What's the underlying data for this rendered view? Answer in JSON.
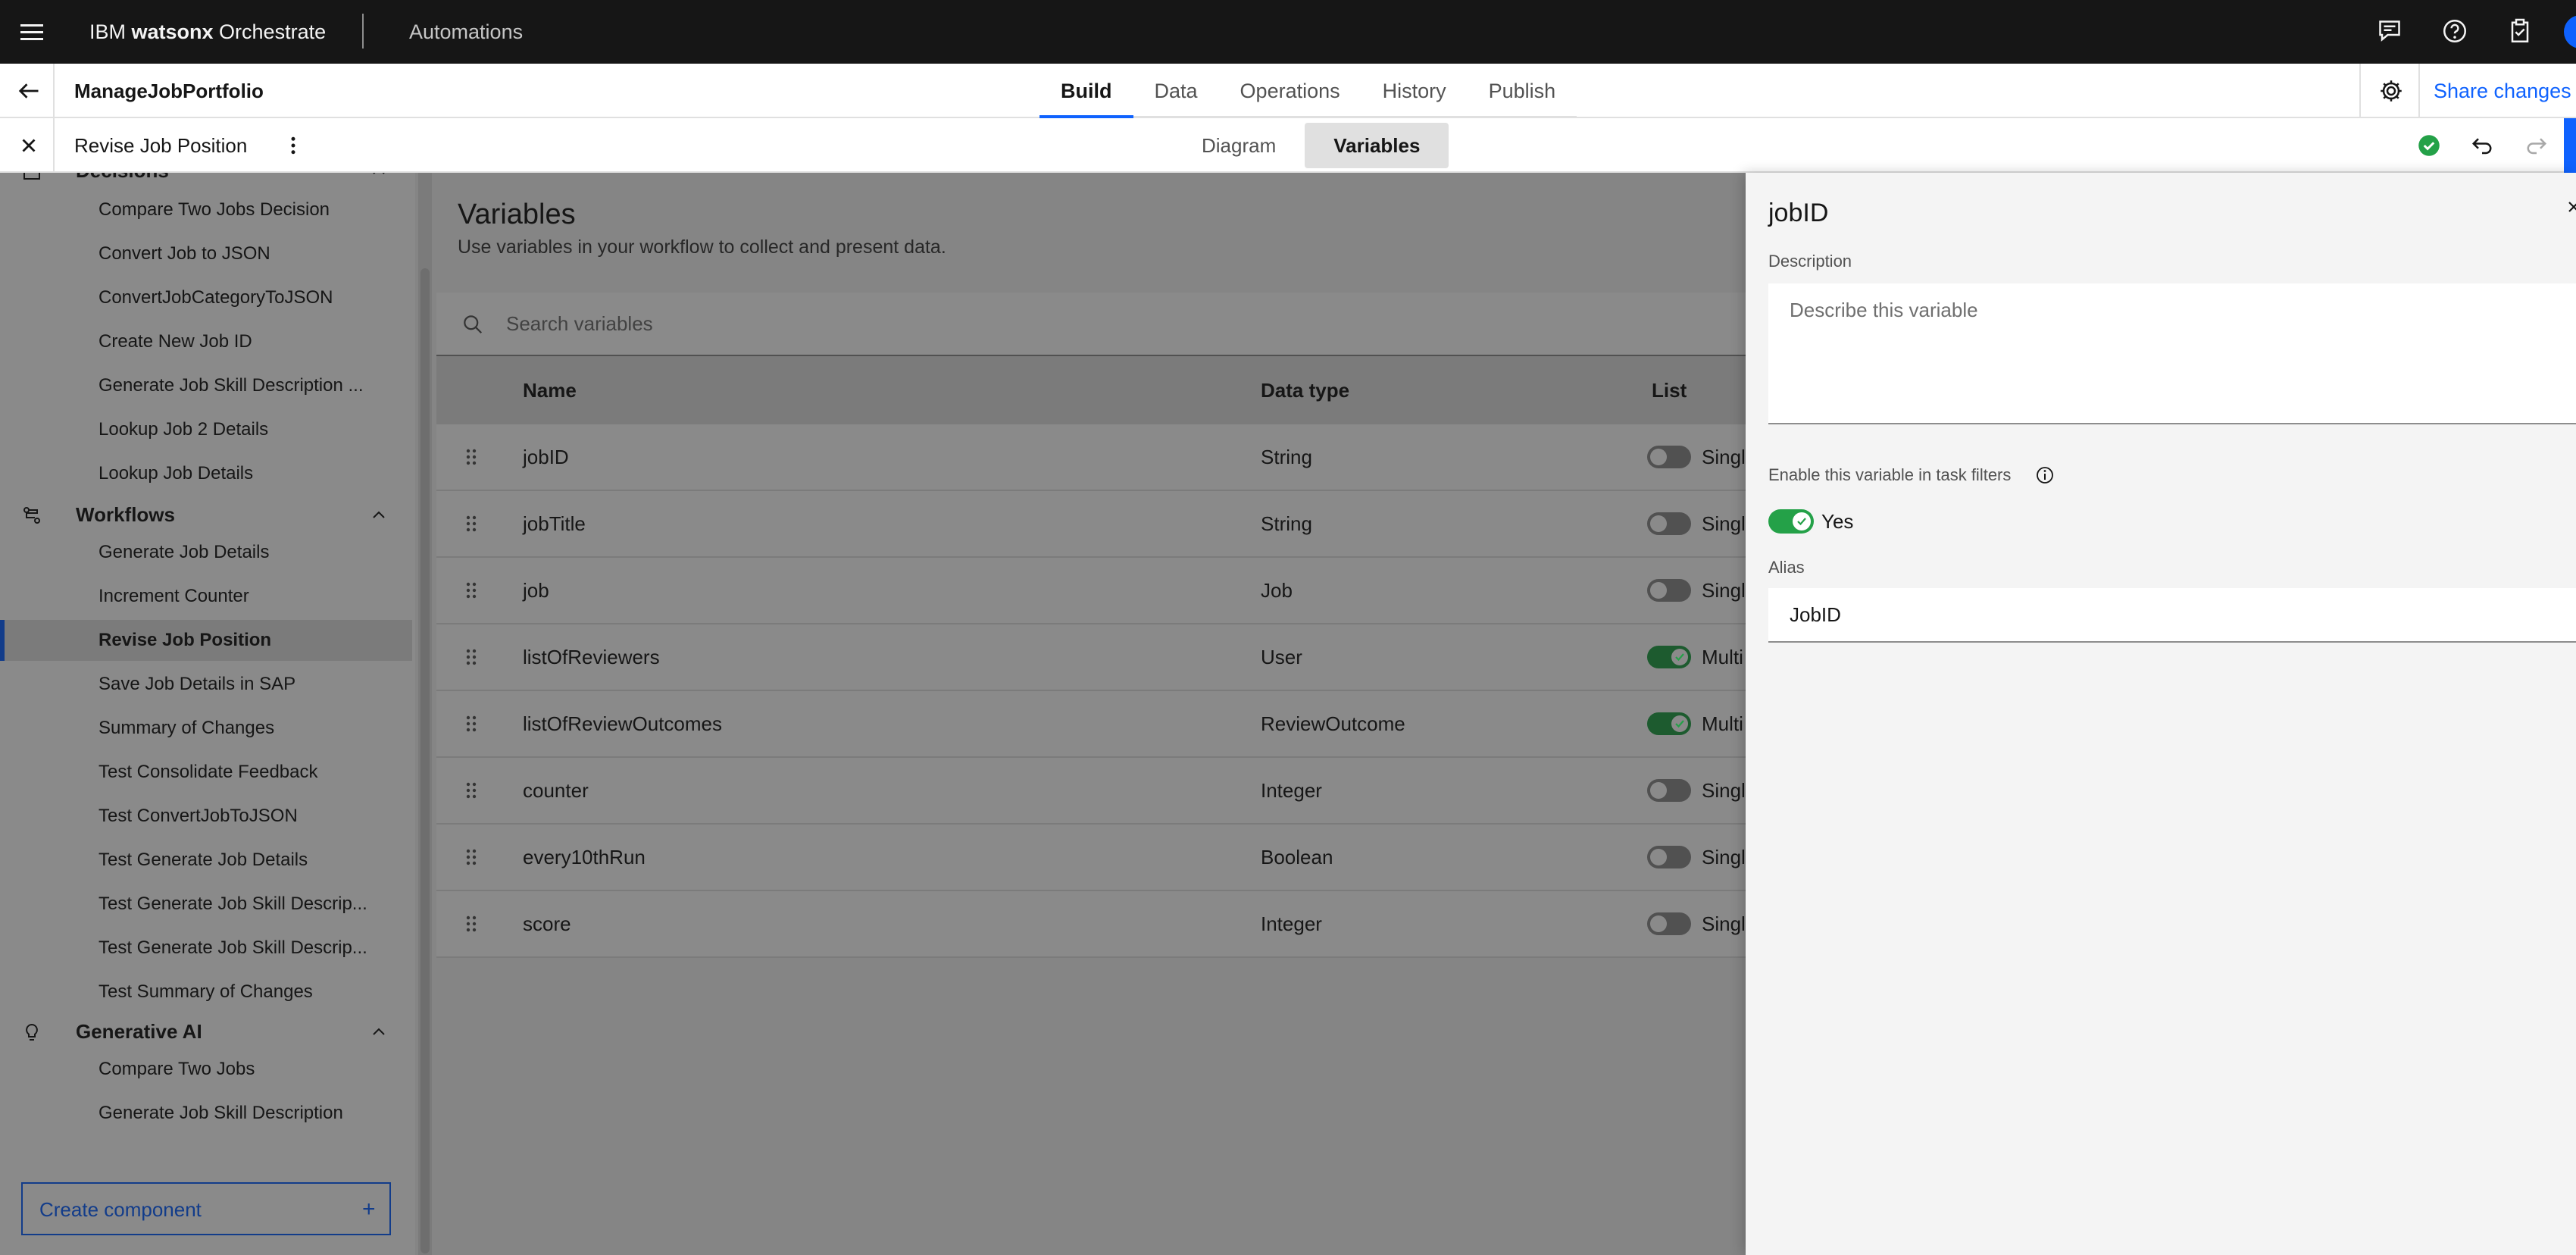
{
  "topbar": {
    "brand_prefix": "IBM ",
    "brand_bold": "watsonx",
    "brand_suffix": " Orchestrate",
    "breadcrumb": "Automations",
    "icons": [
      "chat-icon",
      "help-icon",
      "clipboard-icon",
      "avatar"
    ]
  },
  "project": {
    "name": "ManageJobPortfolio",
    "tabs": [
      {
        "label": "Build",
        "active": true
      },
      {
        "label": "Data",
        "active": false
      },
      {
        "label": "Operations",
        "active": false
      },
      {
        "label": "History",
        "active": false
      },
      {
        "label": "Publish",
        "active": false
      }
    ],
    "share_label": "Share changes"
  },
  "workflow": {
    "title": "Revise Job Position",
    "segments": [
      {
        "label": "Diagram",
        "active": false
      },
      {
        "label": "Variables",
        "active": true
      }
    ]
  },
  "sidebar": {
    "groups": [
      {
        "label": "Decisions",
        "items": [
          "Compare Two Jobs Decision",
          "Convert Job to JSON",
          "ConvertJobCategoryToJSON",
          "Create New Job ID",
          "Generate Job Skill Description ...",
          "Lookup Job 2 Details",
          "Lookup Job Details"
        ]
      },
      {
        "label": "Workflows",
        "items": [
          "Generate Job Details",
          "Increment Counter",
          "Revise Job Position",
          "Save Job Details in SAP",
          "Summary of Changes",
          "Test Consolidate Feedback",
          "Test ConvertJobToJSON",
          "Test Generate Job Details",
          "Test Generate Job Skill Descrip...",
          "Test Generate Job Skill Descrip...",
          "Test Summary of Changes"
        ]
      },
      {
        "label": "Generative AI",
        "items": [
          "Compare Two Jobs",
          "Generate Job Skill Description"
        ]
      }
    ],
    "active_item": "Revise Job Position",
    "create_label": "Create component",
    "create_plus": "+"
  },
  "variables": {
    "title": "Variables",
    "subtitle": "Use variables in your workflow to collect and present data.",
    "search_placeholder": "Search variables",
    "columns": [
      "Name",
      "Data type",
      "List"
    ],
    "rows": [
      {
        "name": "jobID",
        "type": "String",
        "list": false,
        "list_label": "Singl"
      },
      {
        "name": "jobTitle",
        "type": "String",
        "list": false,
        "list_label": "Singl"
      },
      {
        "name": "job",
        "type": "Job",
        "list": false,
        "list_label": "Singl"
      },
      {
        "name": "listOfReviewers",
        "type": "User",
        "list": true,
        "list_label": "Multi"
      },
      {
        "name": "listOfReviewOutcomes",
        "type": "ReviewOutcome",
        "list": true,
        "list_label": "Multi"
      },
      {
        "name": "counter",
        "type": "Integer",
        "list": false,
        "list_label": "Singl"
      },
      {
        "name": "every10thRun",
        "type": "Boolean",
        "list": false,
        "list_label": "Singl"
      },
      {
        "name": "score",
        "type": "Integer",
        "list": false,
        "list_label": "Singl"
      }
    ]
  },
  "panel": {
    "title": "jobID",
    "description_label": "Description",
    "description_placeholder": "Describe this variable",
    "enable_label": "Enable this variable in task filters",
    "enable_value": "Yes",
    "alias_label": "Alias",
    "alias_value": "JobID"
  },
  "colors": {
    "accent": "#0f62fe",
    "success": "#24a148",
    "topbar": "#161616"
  }
}
